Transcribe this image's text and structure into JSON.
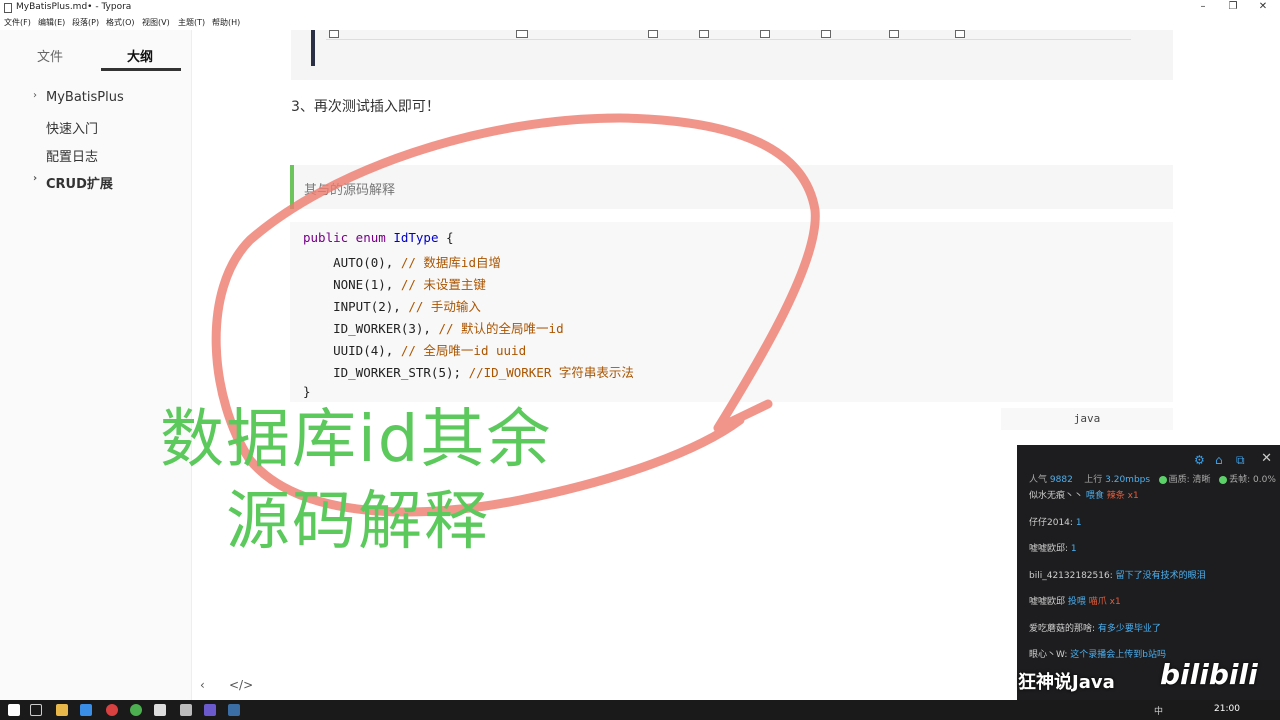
{
  "window": {
    "title": "MyBatisPlus.md• - Typora",
    "minimize": "–",
    "maximize": "❐",
    "close": "✕"
  },
  "menu": [
    "文件(F)",
    "编辑(E)",
    "段落(P)",
    "格式(O)",
    "视图(V)",
    "主题(T)",
    "帮助(H)"
  ],
  "sidebar": {
    "tabs": [
      "文件",
      "大纲"
    ],
    "active_tab": "大纲",
    "items": [
      {
        "label": "MyBatisPlus",
        "expandable": true
      },
      {
        "label": "快速入门",
        "expandable": false
      },
      {
        "label": "配置日志",
        "expandable": false
      },
      {
        "label": "CRUD扩展",
        "expandable": true,
        "bold": true
      }
    ],
    "footer_back": "‹",
    "footer_source": "</>"
  },
  "content": {
    "step": "3、再次测试插入即可！",
    "quote": "其与的源码解释",
    "code_lines": [
      [
        [
          "kw",
          "public enum "
        ],
        [
          "ty",
          "IdType"
        ],
        [
          "pl",
          " {"
        ]
      ],
      [
        [
          "pl",
          "    AUTO(0), "
        ],
        [
          "cm",
          "// 数据库id自增"
        ]
      ],
      [
        [
          "pl",
          "    NONE(1), "
        ],
        [
          "cm",
          "// 未设置主键"
        ]
      ],
      [
        [
          "pl",
          "    INPUT(2), "
        ],
        [
          "cm",
          "// 手动输入"
        ]
      ],
      [
        [
          "pl",
          "    ID_WORKER(3), "
        ],
        [
          "cm",
          "// 默认的全局唯一id"
        ]
      ],
      [
        [
          "pl",
          "    UUID(4), "
        ],
        [
          "cm",
          "// 全局唯一id uuid"
        ]
      ],
      [
        [
          "pl",
          "    ID_WORKER_STR(5); "
        ],
        [
          "cm",
          "//ID_WORKER 字符串表示法"
        ]
      ],
      [
        [
          "pl",
          "}"
        ]
      ]
    ],
    "code_language": "java",
    "overlay_line1": "数据库id其余",
    "overlay_line2": "源码解释"
  },
  "live_panel": {
    "popularity_label": "人气",
    "popularity": "9882",
    "upload_label": "上行",
    "upload": "3.20mbps",
    "quality_label": "画质: 清晰",
    "drop_label": "丢帧: 0.0%",
    "messages": [
      {
        "user": "似水无痕丶丶",
        "text": "喂食",
        "gift": "辣条 x1"
      },
      {
        "user": "仔仔2014:",
        "text": "1"
      },
      {
        "user": "嘘嘘欧邱:",
        "text": "1"
      },
      {
        "user": "bili_42132182516:",
        "text": "留下了没有技术的眼泪"
      },
      {
        "user": "嘘嘘欧邱",
        "text": "投喂",
        "gift": "喵爪 x1"
      },
      {
        "user": "爱吃蘑菇的那啥:",
        "text": "有多少要毕业了"
      },
      {
        "user": "眼心丶W:",
        "text": "这个录播会上传到b站吗"
      }
    ]
  },
  "watermark": {
    "channel": "狂神说Java",
    "site": "bilibili"
  },
  "taskbar": {
    "time": "21:00",
    "ime": "中"
  },
  "colors": {
    "accent_green": "#5cc95c",
    "annotation_red": "#ee7a6e",
    "chat_link": "#4bb0f0"
  }
}
